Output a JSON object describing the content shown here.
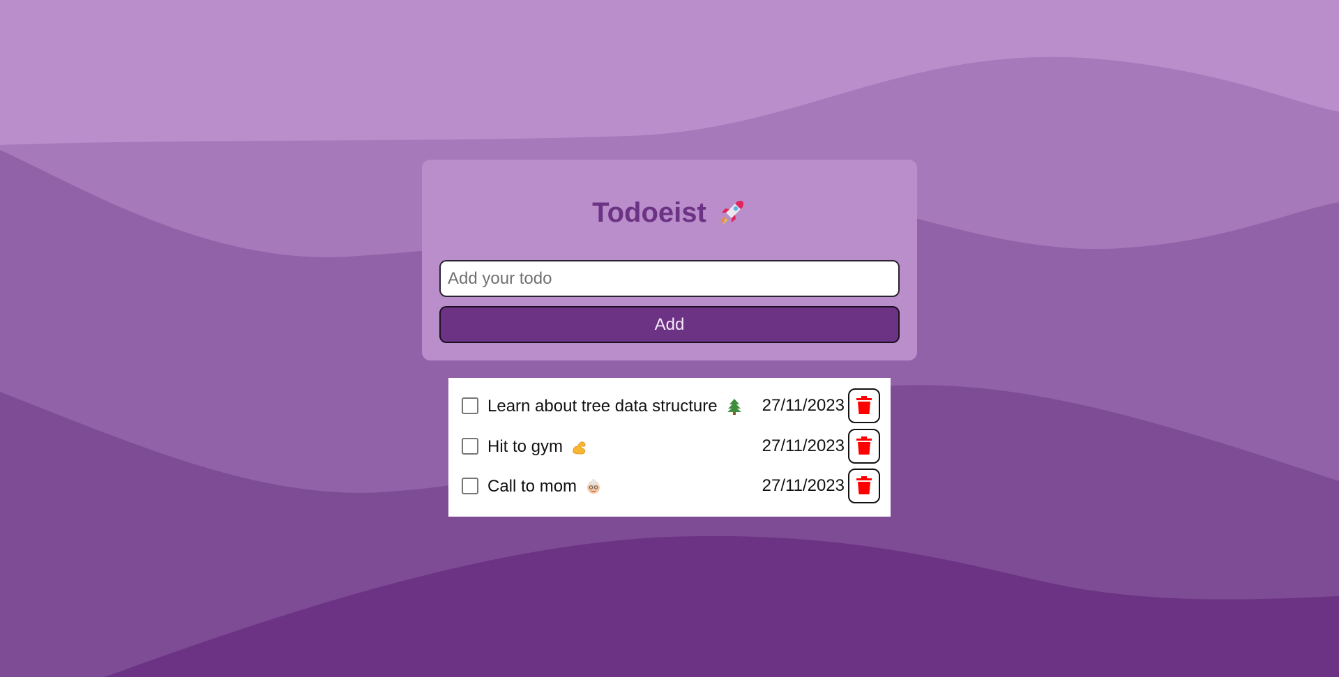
{
  "app": {
    "title": "Todoeist",
    "title_icon": "rocket-icon"
  },
  "form": {
    "input_placeholder": "Add your todo",
    "input_value": "",
    "add_label": "Add"
  },
  "todos": [
    {
      "text": "Learn about tree data structure",
      "emoji": "tree-icon",
      "date": "27/11/2023",
      "checked": false
    },
    {
      "text": "Hit to gym",
      "emoji": "flexed-biceps-icon",
      "date": "27/11/2023",
      "checked": false
    },
    {
      "text": "Call to mom",
      "emoji": "grandma-icon",
      "date": "27/11/2023",
      "checked": false
    }
  ],
  "colors": {
    "background_light": "#b98ecb",
    "background_wave_1": "#a579ba",
    "background_wave_2": "#9262a8",
    "background_wave_3": "#7e4c95",
    "background_wave_4": "#6c3384",
    "accent": "#6c3384",
    "delete_icon": "#ff0000"
  }
}
